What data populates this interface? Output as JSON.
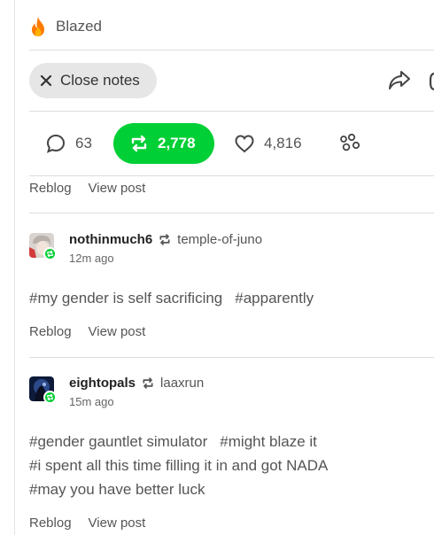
{
  "header": {
    "blazed_label": "Blazed",
    "close_notes_label": "Close notes"
  },
  "counts": {
    "comments": "63",
    "reblogs": "2,778",
    "likes": "4,816"
  },
  "actions": {
    "reblog_label": "Reblog",
    "view_post_label": "View post"
  },
  "notes": [
    {
      "username": "nothinmuch6",
      "reblogged_from": "temple-of-juno",
      "time": "12m ago",
      "tag_lines": [
        [
          "#my gender is self sacrificing",
          "#apparently"
        ]
      ]
    },
    {
      "username": "eightopals",
      "reblogged_from": "laaxrun",
      "time": "15m ago",
      "tag_lines": [
        [
          "#gender gauntlet simulator",
          "#might blaze it"
        ],
        [
          "#i spent all this time filling it in and got NADA"
        ],
        [
          "#may you have better luck"
        ]
      ]
    }
  ],
  "colors": {
    "accent_green": "#00cf35",
    "flame_orange": "#ff7a00",
    "pill_gray": "#e6e6e6"
  },
  "icons": [
    "flame-icon",
    "close-icon",
    "share-icon",
    "more-icon",
    "comment-icon",
    "reblog-icon",
    "heart-icon",
    "blaze-icon"
  ]
}
